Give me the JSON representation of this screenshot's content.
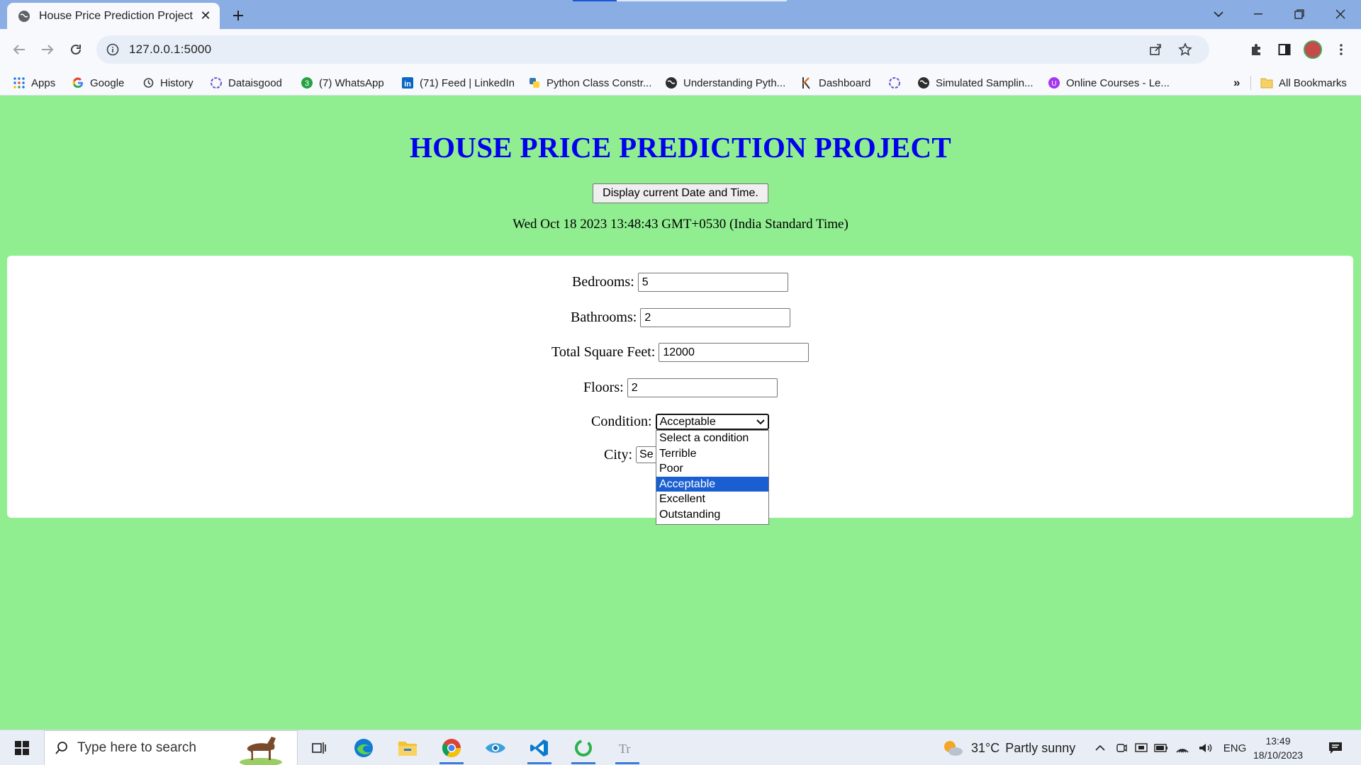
{
  "browser": {
    "tab_title": "House Price Prediction Project",
    "url": "127.0.0.1:5000",
    "bookmarks": [
      {
        "label": "Apps",
        "icon": "apps-grid-icon"
      },
      {
        "label": "Google",
        "icon": "google-icon"
      },
      {
        "label": "History",
        "icon": "history-icon"
      },
      {
        "label": "Dataisgood",
        "icon": "openai-icon"
      },
      {
        "label": "(7) WhatsApp",
        "icon": "whatsapp-icon"
      },
      {
        "label": "(71) Feed | LinkedIn",
        "icon": "linkedin-icon"
      },
      {
        "label": "Python Class Constr...",
        "icon": "python-icon"
      },
      {
        "label": "Understanding Pyth...",
        "icon": "globe-icon"
      },
      {
        "label": "Dashboard",
        "icon": "kaggle-icon"
      },
      {
        "label": "",
        "icon": "openai-icon"
      },
      {
        "label": "Simulated Samplin...",
        "icon": "globe-icon"
      },
      {
        "label": "Online Courses - Le...",
        "icon": "udemy-icon"
      }
    ],
    "all_bookmarks": "All Bookmarks",
    "more_bookmarks": "»"
  },
  "page": {
    "title": "HOUSE PRICE PREDICTION PROJECT",
    "datetime_button": "Display current Date and Time.",
    "datetime_text": "Wed Oct 18 2023 13:48:43 GMT+0530 (India Standard Time)"
  },
  "form": {
    "bedrooms_label": "Bedrooms:",
    "bedrooms_value": "5",
    "bathrooms_label": "Bathrooms:",
    "bathrooms_value": "2",
    "sqft_label": "Total Square Feet:",
    "sqft_value": "12000",
    "floors_label": "Floors:",
    "floors_value": "2",
    "condition_label": "Condition:",
    "condition_value": "Acceptable",
    "condition_options": [
      "Select a condition",
      "Terrible",
      "Poor",
      "Acceptable",
      "Excellent",
      "Outstanding"
    ],
    "condition_selected_index": 3,
    "city_label": "City:",
    "city_value": "Se"
  },
  "taskbar": {
    "search_placeholder": "Type here to search",
    "weather_temp": "31°C",
    "weather_desc": "Partly sunny",
    "language": "ENG",
    "time": "13:49",
    "date": "18/10/2023"
  },
  "colors": {
    "page_bg": "#90ee90",
    "title": "#0000ee",
    "selected_option": "#1a5fd1"
  }
}
